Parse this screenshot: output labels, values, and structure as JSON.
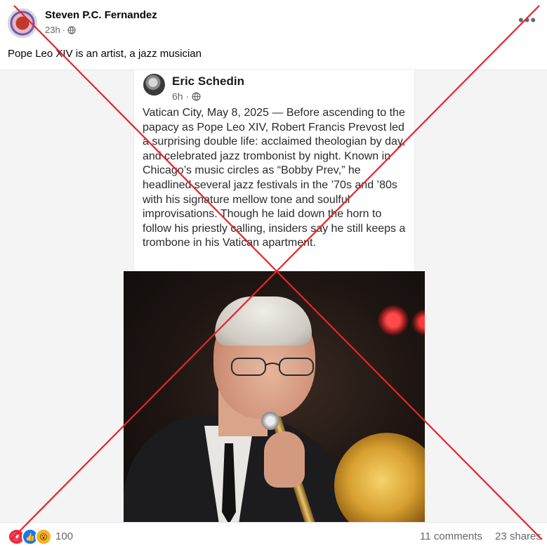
{
  "post": {
    "author": "Steven P.C. Fernandez",
    "timestamp": "23h",
    "separator": "·",
    "privacy_icon": "globe-icon",
    "more_icon": "more-horizontal-icon",
    "more_label": "•••",
    "caption": "Pope Leo XIV is an artist, a jazz musician"
  },
  "shared_post": {
    "author": "Eric Schedin",
    "timestamp": "6h",
    "separator": "·",
    "privacy_icon": "globe-icon",
    "text": "Vatican City, May 8, 2025 — Before ascending to the papacy as Pope Leo XIV, Robert Francis Prevost led a surprising double life: acclaimed theologian by day, and celebrated jazz trombonist by night. Known in Chicago’s music circles as “Bobby Prev,” he headlined several jazz festivals in the ’70s and ’80s with his signature mellow tone and soulful improvisations. Though he laid down the horn to follow his priestly calling, insiders say he still keeps a trombone in his Vatican apartment."
  },
  "footer": {
    "reaction_icons": [
      "love-reaction-icon",
      "like-reaction-icon",
      "wow-reaction-icon"
    ],
    "reaction_glyphs": [
      "♥",
      "👍",
      "😮"
    ],
    "reaction_count": "100",
    "comments": "11 comments",
    "shares": "23 shares"
  },
  "colors": {
    "overlay_cross": "#e8232a",
    "meta_gray": "#65676b",
    "like_blue": "#1877f2",
    "love_red": "#f33e58",
    "wow_yellow": "#f7b125"
  }
}
